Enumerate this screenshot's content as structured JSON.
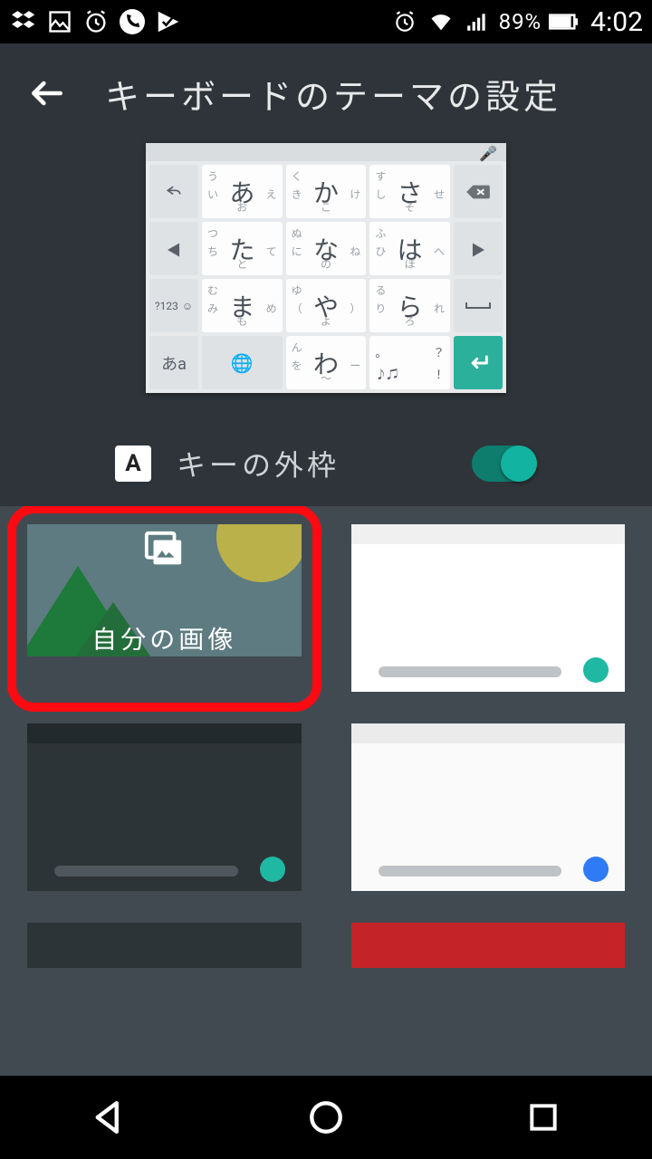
{
  "statusbar": {
    "battery_pct": "89%",
    "clock": "4:02"
  },
  "header": {
    "title": "キーボードのテーマの設定"
  },
  "keyboard_preview": {
    "row1": [
      {
        "side_left": "←",
        "l": "い",
        "big": "あ",
        "r": "え",
        "b": "お",
        "t": "う",
        "side_right": "⌫"
      },
      {
        "l": "き",
        "big": "か",
        "r": "け",
        "b": "こ",
        "t": "く"
      },
      {
        "l": "し",
        "big": "さ",
        "r": "せ",
        "b": "そ",
        "t": "す"
      }
    ],
    "row2": [
      {
        "side_left": "◀",
        "l": "ち",
        "big": "た",
        "r": "て",
        "b": "と",
        "t": "つ",
        "side_right": "▶"
      },
      {
        "l": "に",
        "big": "な",
        "r": "ね",
        "b": "の",
        "t": "ぬ"
      },
      {
        "l": "ひ",
        "big": "は",
        "r": "へ",
        "b": "ほ",
        "t": "ふ"
      }
    ],
    "row3": [
      {
        "side_left": "?123 ☺",
        "l": "み",
        "big": "ま",
        "r": "め",
        "b": "も",
        "t": "む",
        "side_right": "␣"
      },
      {
        "l": "（",
        "big": "や",
        "r": "）",
        "b": "よ",
        "t": "ゆ"
      },
      {
        "l": "り",
        "big": "ら",
        "r": "れ",
        "b": "ろ",
        "t": "る"
      }
    ],
    "row4": {
      "mode": "あa",
      "globe": "🌐",
      "wa": {
        "l": "を",
        "big": "わ",
        "r": "ー",
        "b": "〜",
        "t": "ん"
      },
      "punct": {
        "tl": "。",
        "tr": "？",
        "bl": "♪♫",
        "br": "！"
      },
      "enter": "↵"
    }
  },
  "toggle": {
    "badge": "A",
    "label": "キーの外枠",
    "on": true
  },
  "themes": {
    "own_image_label": "自分の画像"
  }
}
